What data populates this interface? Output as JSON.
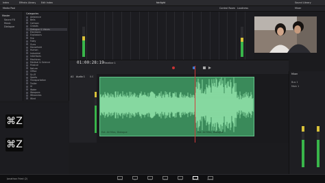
{
  "app": {
    "project_name": "fairlight",
    "user": "Jonathan Fried (2)"
  },
  "topbar": {
    "tabs": [
      "Index",
      "Effects Library",
      "Edit Index",
      "Sound Library"
    ]
  },
  "subbar": {
    "left_tab": "Media Pool",
    "right_tab": "Mixer",
    "control_room": "Control Room",
    "loudness": "Loudness",
    "monitor": "Monitor"
  },
  "leftpanel": {
    "master_label": "Master",
    "label_1": "Sound FX",
    "label_2": "Music",
    "label_3": "Dialogue"
  },
  "categories": {
    "header": "Categories",
    "items": [
      "Ambience",
      "Bells",
      "Cartoon",
      "Crowds",
      "Dialogue & Voices",
      "Electronic",
      "Explosions",
      "Fire",
      "Foley",
      "Guns",
      "Household",
      "Human",
      "Industrial",
      "Interfaces",
      "Machines",
      "Medical & Science",
      "Musical",
      "Nature",
      "Office",
      "Sci-Fi",
      "Sports",
      "Transportation",
      "Trailer",
      "UI",
      "Water",
      "Weapons",
      "Whooshes",
      "Wind"
    ],
    "selected_index": 4
  },
  "mixer": {
    "meters": [
      0.0,
      0.55,
      0.0,
      0.0,
      0.0,
      0.0,
      0.0,
      0.0,
      0.0,
      0.0,
      0.0,
      0.0,
      0.0,
      0.0,
      0.0,
      0.0,
      0.0,
      0.0,
      0.0,
      0.5
    ],
    "peak": 0.8
  },
  "transport": {
    "timecode": "01:00:28:19",
    "timeline_name": "Timeline 1"
  },
  "track": {
    "name": "Audio 1",
    "label": "A1",
    "volume_db": "0.0"
  },
  "clip": {
    "label_left": "Ext. All Mics, Dialogue",
    "label_right": "Ext. All Mics, Dialogue"
  },
  "rightpanel": {
    "header": "Mixer",
    "bus_label": "Bus 1",
    "main_label": "Main 1"
  },
  "undo": {
    "symbol": "⌘Z"
  },
  "bottombar": {
    "pages": [
      "Media",
      "Cut",
      "Edit",
      "Fusion",
      "Color",
      "Fairlight",
      "Deliver"
    ],
    "active_index": 5
  }
}
